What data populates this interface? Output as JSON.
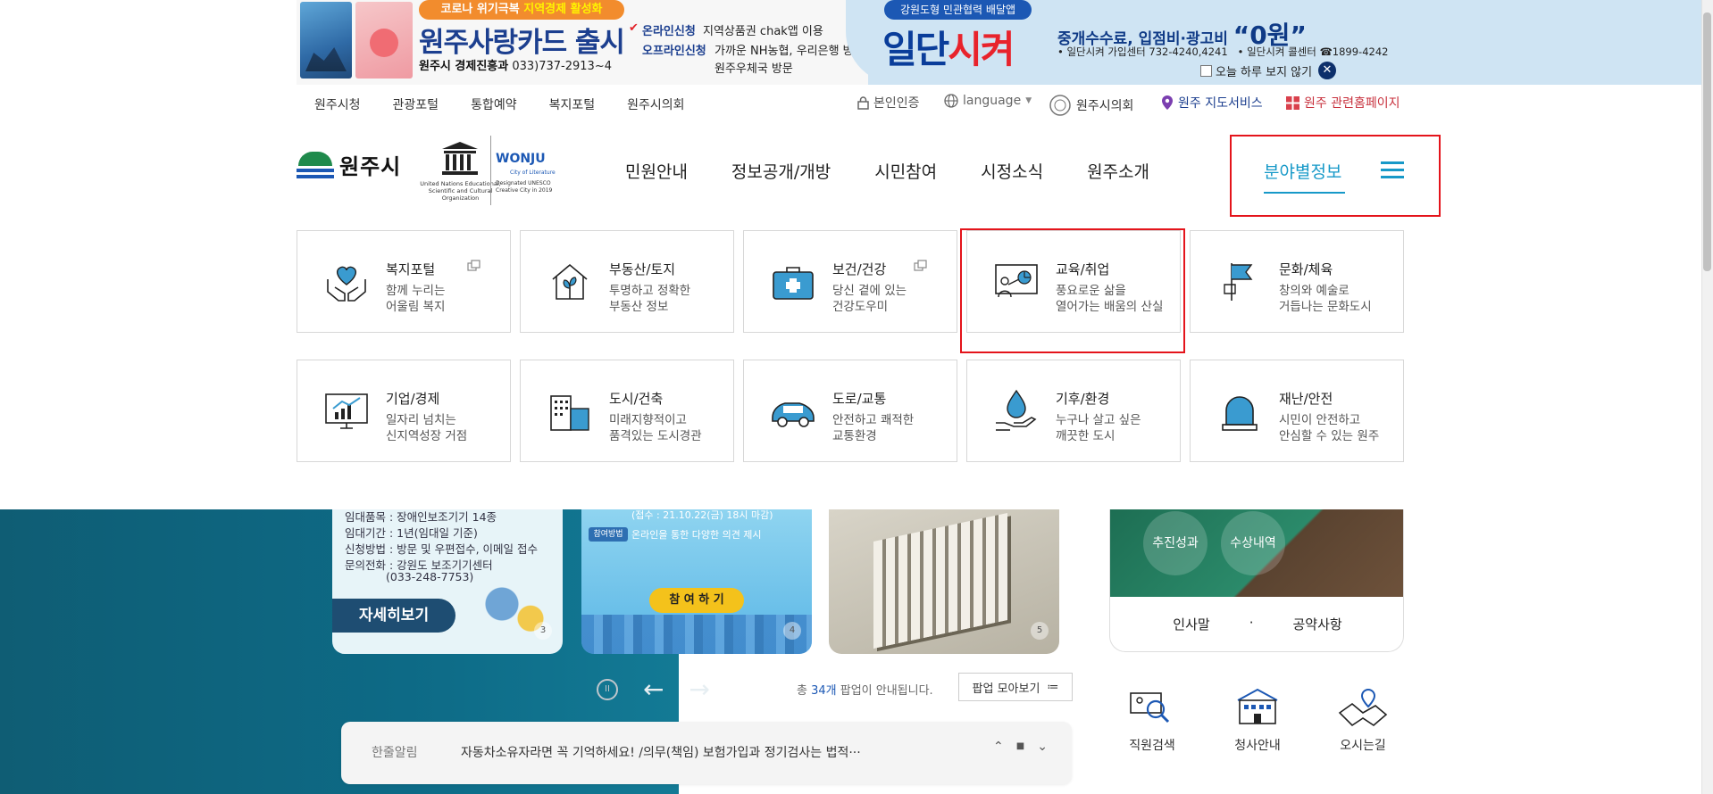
{
  "banner": {
    "pill_prefix": "코로나 위기극복 ",
    "pill_bold": "지역경제 활성화",
    "title": "원주사랑카드 출시",
    "sub_bold": "원주시 경제진흥과",
    "sub_rest": " 033)737-2913~4",
    "line1_key": "온라인신청",
    "line1_val": "지역상품권 chak앱 이용",
    "line2_key": "오프라인신청",
    "line2_val": "가까운 NH농협, 우리은행 방문,",
    "line3_val": "원주우체국 방문",
    "app_pill": "강원도형 민관협력 배달앱",
    "app_logo_a": "일단",
    "app_logo_b": "시켜",
    "fee_text": "중개수수료, 입점비·광고비 ",
    "fee_big": "“0원”",
    "info1": "• 일단시켜 가입센터 732-4240,4241",
    "info2": "• 일단시켜 콜센터 ☎1899-4242",
    "noshow": "오늘 하루 보지 않기",
    "close": "✕"
  },
  "util": {
    "links": [
      "원주시청",
      "관광포털",
      "통합예약",
      "복지포털",
      "원주시의회"
    ],
    "auth": "본인인증",
    "lang": "language",
    "council": "원주시의회",
    "map": "원주 지도서비스",
    "sites": "원주 관련홈페이지"
  },
  "logo": {
    "name": "원주시",
    "unesco_cap": "United Nations Educational, Scientific and Cultural Organization",
    "wonju": "WONJU",
    "city_of": "City of Literature",
    "designated": "Designated UNESCO Creative City in 2019"
  },
  "gnb": {
    "items": [
      "민원안내",
      "정보공개/개방",
      "시민참여",
      "시정소식",
      "원주소개"
    ],
    "active": "분야별정보"
  },
  "tiles": [
    {
      "title": "복지포털",
      "d1": "함께 누리는",
      "d2": "어울림 복지"
    },
    {
      "title": "부동산/토지",
      "d1": "투명하고 정확한",
      "d2": "부동산 정보"
    },
    {
      "title": "보건/건강",
      "d1": "당신 곁에 있는",
      "d2": "건강도우미"
    },
    {
      "title": "교육/취업",
      "d1": "풍요로운 삶을",
      "d2": "열어가는 배움의 산실"
    },
    {
      "title": "문화/체육",
      "d1": "창의와 예술로",
      "d2": "거듭나는 문화도시"
    },
    {
      "title": "기업/경제",
      "d1": "일자리 넘치는",
      "d2": "신지역성장 거점"
    },
    {
      "title": "도시/건축",
      "d1": "미래지향적이고",
      "d2": "품격있는 도시경관"
    },
    {
      "title": "도로/교통",
      "d1": "안전하고 쾌적한",
      "d2": "교통환경"
    },
    {
      "title": "기후/환경",
      "d1": "누구나 살고 싶은",
      "d2": "깨끗한 도시"
    },
    {
      "title": "재난/안전",
      "d1": "시민이 안전하고",
      "d2": "안심할 수 있는 원주"
    }
  ],
  "popups": {
    "p1_l1": "임대품목 : 장애인보조기기 14종",
    "p1_l2": "임대기간 : 1년(임대일 기준)",
    "p1_l3": "신청방법 : 방문 및 우편접수, 이메일 접수",
    "p1_l4": "문의전화 : 강원도 보조기기센터",
    "p1_l5": "(033-248-7753)",
    "p1_btn": "자세히보기",
    "p2_top": "(접수 : 21.10.22(금) 18시 마감)",
    "p2_tag": "참여방법",
    "p2_text": "온라인을 통한 다양한 의견 제시",
    "p2_btn": "참 여 하 기",
    "n1": "3",
    "n2": "4",
    "n3": "5"
  },
  "slider": {
    "pause": "II",
    "prev": "←",
    "next": "→",
    "count_pre": "총 ",
    "count_num": "34개",
    "count_post": " 팝업이 안내됩니다.",
    "popall": "팝업 모아보기",
    "popall_icon": "≔"
  },
  "notice": {
    "label": "한줄알림",
    "text": "자동차소유자라면 꼭 기억하세요! /의무(책임) 보험가입과 정기검사는 법적···",
    "up": "⌃",
    "stop": "■",
    "down": "⌄"
  },
  "mayor": {
    "c1": "추진성과",
    "c2": "수상내역",
    "link1": "인사말",
    "sep": "·",
    "link2": "공약사항"
  },
  "quick": [
    "직원검색",
    "청사안내",
    "오시는길"
  ]
}
